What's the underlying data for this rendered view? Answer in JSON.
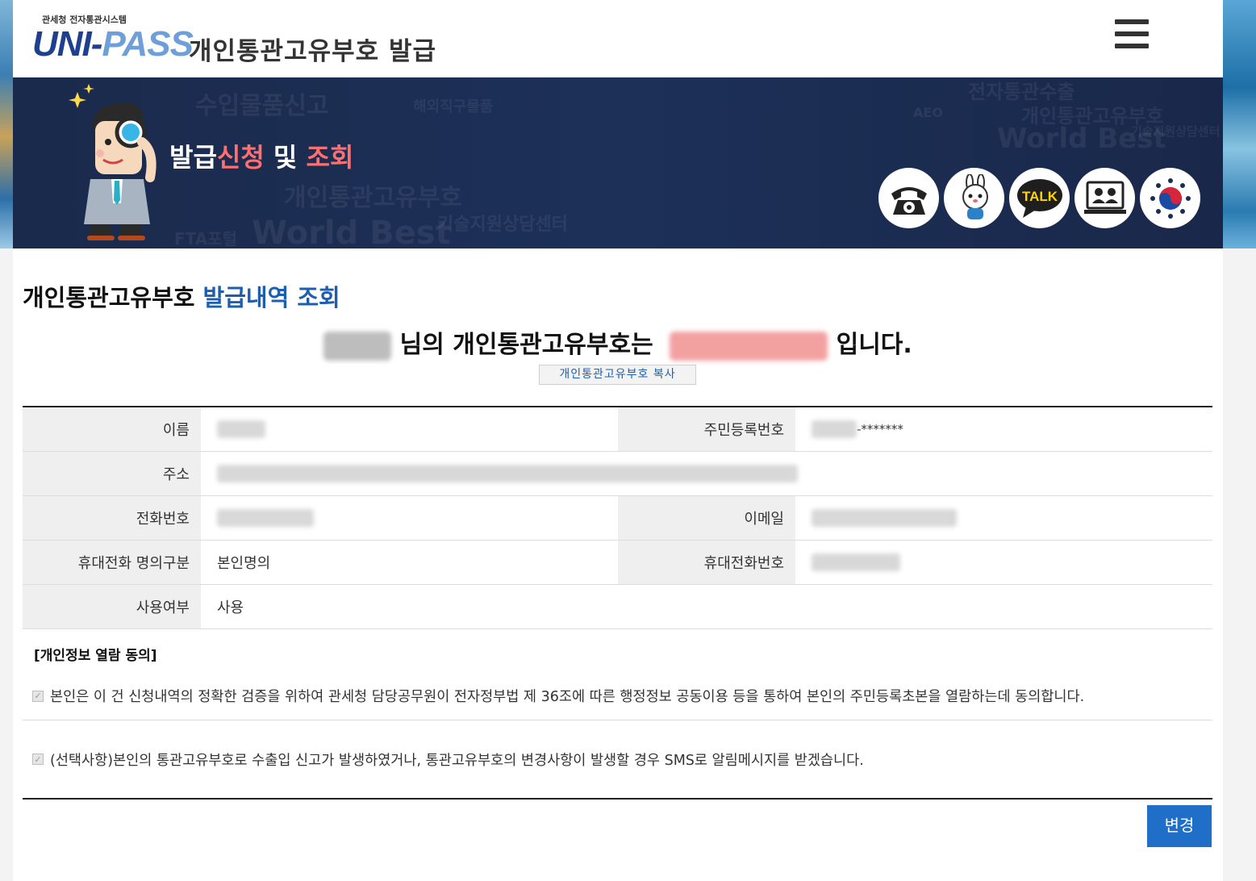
{
  "header": {
    "logo_small": "관세청 전자통관시스템",
    "logo_uni": "UNI-",
    "logo_pass": "PASS",
    "title": "개인통관고유부호 발급"
  },
  "banner": {
    "title_part1": "발급",
    "title_part2": "신청",
    "title_part3": " 및 ",
    "title_part4": "조회",
    "bg_words": [
      "수입물품신고",
      "개인통관고유부호",
      "World Best",
      "기술지원상담센터",
      "FTA포털",
      "전자통관수출",
      "해외직구물품",
      "AEO"
    ],
    "icons": [
      "phone-icon",
      "mascot-icon",
      "talk-icon",
      "video-call-icon",
      "government-emblem-icon"
    ],
    "talk_label": "TALK"
  },
  "section": {
    "title_black": "개인통관고유부호",
    "title_blue": " 발급내역 조회"
  },
  "result": {
    "middle_text": "님의 개인통관고유부호는",
    "end_text": "입니다.",
    "copy_button": "개인통관고유부호 복사"
  },
  "table": {
    "name_label": "이름",
    "rrn_label": "주민등록번호",
    "rrn_suffix": "-*******",
    "address_label": "주소",
    "phone_label": "전화번호",
    "email_label": "이메일",
    "mobile_owner_label": "휴대전화 명의구분",
    "mobile_owner_value": "본인명의",
    "mobile_label": "휴대전화번호",
    "use_label": "사용여부",
    "use_value": "사용"
  },
  "consent": {
    "heading": "[개인정보 열람 동의]",
    "item1": "본인은 이 건 신청내역의 정확한 검증을 위하여 관세청 담당공무원이 전자정부법 제 36조에 따른 행정정보 공동이용 등을 통하여 본인의 주민등록초본을 열람하는데 동의합니다.",
    "item2": "(선택사항)본인의 통관고유부호로 수출입 신고가 발생하였거나, 통관고유부호의 변경사항이 발생할 경우 SMS로 알림메시지를 받겠습니다."
  },
  "actions": {
    "change_button": "변경"
  }
}
